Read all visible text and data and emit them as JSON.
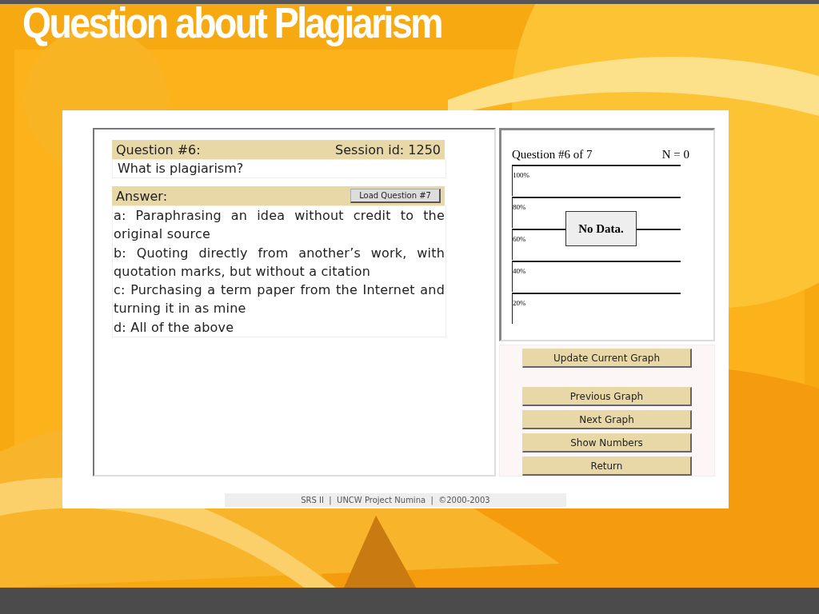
{
  "slide": {
    "title": "Question about Plagiarism"
  },
  "question_panel": {
    "question_label": "Question #6:",
    "session": "Session id: 1250",
    "question": "What is plagiarism?",
    "answer_label": "Answer:",
    "load_button": "Load Question #7",
    "answers": [
      "a: Paraphrasing an idea without credit to the original source",
      "b: Quoting directly from another’s work, with quotation marks, but without a citation",
      "c: Purchasing a term paper from the Internet and turning it in as mine",
      "d: All of the above"
    ]
  },
  "graph": {
    "title": "Question #6 of 7",
    "count": "N = 0",
    "axis_labels": [
      "100%",
      "80%",
      "60%",
      "40%",
      "20%"
    ],
    "message": "No Data."
  },
  "buttons": [
    {
      "label": "Update Current Graph",
      "kind": "spaced"
    },
    {
      "label": "Previous Graph",
      "kind": "plain"
    },
    {
      "label": "Next Graph",
      "kind": "plain"
    },
    {
      "label": "Show Numbers",
      "kind": "plain"
    },
    {
      "label": "Return",
      "kind": "plain"
    }
  ],
  "footer": "SRS II  |  UNCW Project Numina  |  ©2000-2003"
}
